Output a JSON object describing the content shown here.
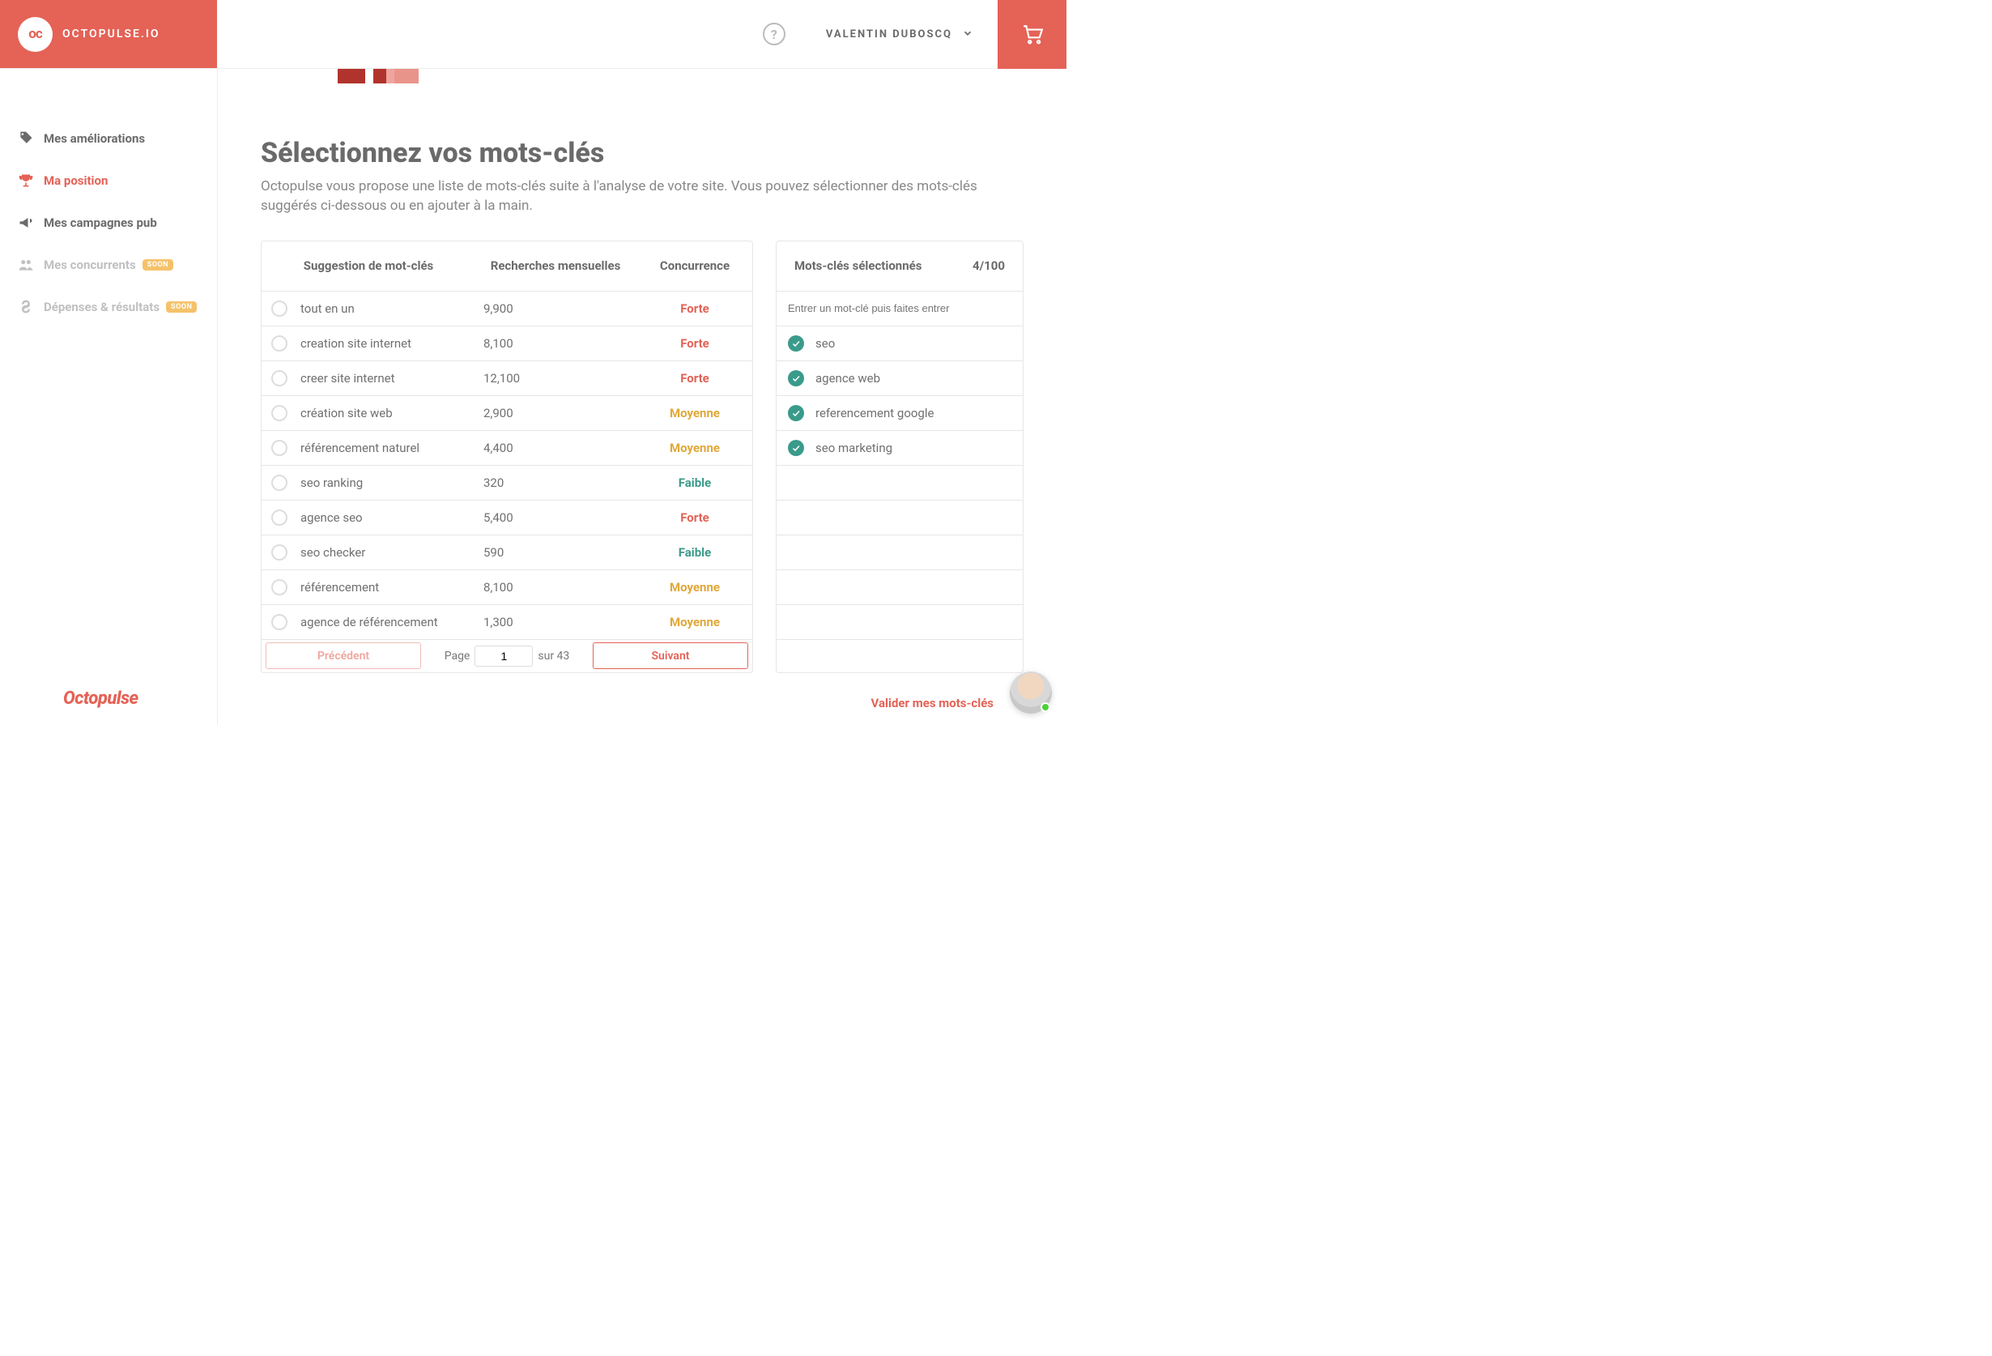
{
  "header": {
    "logo_badge": "oc",
    "logo_text": "OCTOPULSE.IO",
    "user_name": "VALENTIN DUBOSCQ"
  },
  "sidebar": {
    "items": [
      {
        "label": "Mes améliorations",
        "icon": "tag-icon",
        "state": "normal"
      },
      {
        "label": "Ma position",
        "icon": "trophy-icon",
        "state": "active"
      },
      {
        "label": "Mes campagnes pub",
        "icon": "megaphone-icon",
        "state": "normal"
      },
      {
        "label": "Mes concurrents",
        "icon": "people-icon",
        "state": "dim",
        "badge": "SOON"
      },
      {
        "label": "Dépenses & résultats",
        "icon": "money-icon",
        "state": "dim",
        "badge": "SOON"
      }
    ],
    "brand": "Octopulse"
  },
  "page": {
    "title": "Sélectionnez vos mots-clés",
    "subtitle": "Octopulse vous propose une liste de mots-clés suite à l'analyse de votre site. Vous pouvez sélectionner des mots-clés suggérés ci-dessous ou en ajouter à la main."
  },
  "table": {
    "headers": {
      "kw": "Suggestion de mot-clés",
      "search": "Recherches mensuelles",
      "comp": "Concurrence"
    },
    "rows": [
      {
        "kw": "tout en un",
        "search": "9,900",
        "comp": "Forte",
        "level": "forte"
      },
      {
        "kw": "creation site internet",
        "search": "8,100",
        "comp": "Forte",
        "level": "forte"
      },
      {
        "kw": "creer site internet",
        "search": "12,100",
        "comp": "Forte",
        "level": "forte"
      },
      {
        "kw": "création site web",
        "search": "2,900",
        "comp": "Moyenne",
        "level": "moyenne"
      },
      {
        "kw": "référencement naturel",
        "search": "4,400",
        "comp": "Moyenne",
        "level": "moyenne"
      },
      {
        "kw": "seo ranking",
        "search": "320",
        "comp": "Faible",
        "level": "faible"
      },
      {
        "kw": "agence seo",
        "search": "5,400",
        "comp": "Forte",
        "level": "forte"
      },
      {
        "kw": "seo checker",
        "search": "590",
        "comp": "Faible",
        "level": "faible"
      },
      {
        "kw": "référencement",
        "search": "8,100",
        "comp": "Moyenne",
        "level": "moyenne"
      },
      {
        "kw": "agence de référencement",
        "search": "1,300",
        "comp": "Moyenne",
        "level": "moyenne"
      }
    ],
    "footer": {
      "prev": "Précédent",
      "next": "Suivant",
      "page_label": "Page",
      "page_value": "1",
      "total_label": "sur 43"
    }
  },
  "selected": {
    "title": "Mots-clés sélectionnés",
    "count": "4/100",
    "input_placeholder": "Entrer un mot-clé puis faites entrer",
    "items": [
      "seo",
      "agence web",
      "referencement google",
      "seo marketing"
    ]
  },
  "actions": {
    "validate": "Valider mes mots-clés"
  },
  "colors": {
    "accent": "#e46256",
    "teal": "#3a9b8b",
    "amber": "#e0a838"
  }
}
